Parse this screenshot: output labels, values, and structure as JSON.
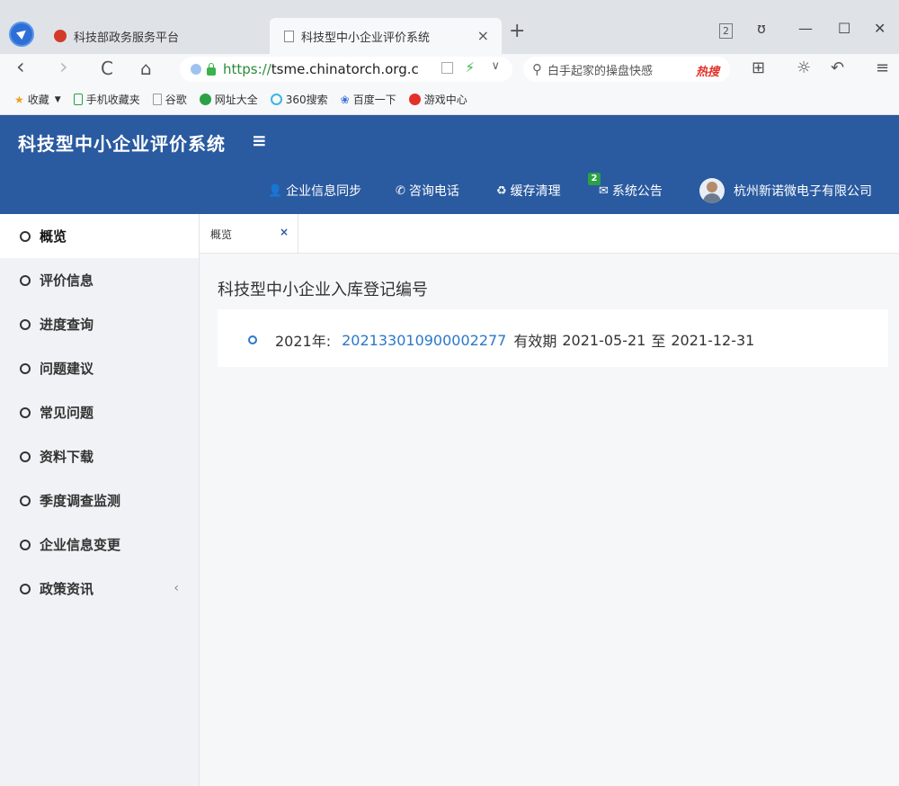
{
  "browser": {
    "tabs": [
      {
        "title": "科技部政务服务平台",
        "active": false
      },
      {
        "title": "科技型中小企业评价系统",
        "active": true
      }
    ],
    "new_tab": "+",
    "tab_count": "2",
    "window_controls": {
      "skin": "ʊ",
      "minimize": "—",
      "maximize": "☐",
      "close": "✕"
    },
    "nav": {
      "back": "‹",
      "forward": "›",
      "reload": "C",
      "home": "⌂"
    },
    "address": {
      "scheme": "https://",
      "host": "tsme.chinatorch.org.c"
    },
    "search": {
      "text": "白手起家的操盘快感",
      "hot_label": "热搜"
    },
    "bookmarks": [
      {
        "label": "收藏",
        "icon": "star-icon",
        "color": "#f0a020"
      },
      {
        "label": "手机收藏夹",
        "icon": "phone-icon",
        "color": "#2aa146"
      },
      {
        "label": "谷歌",
        "icon": "page-icon",
        "color": "#999999"
      },
      {
        "label": "网址大全",
        "icon": "globe-icon",
        "color": "#2aa146"
      },
      {
        "label": "360搜索",
        "icon": "search360-icon",
        "color": "#3cb5e5"
      },
      {
        "label": "百度一下",
        "icon": "paw-icon",
        "color": "#3a6fd6"
      },
      {
        "label": "游戏中心",
        "icon": "game-icon",
        "color": "#e3312a"
      }
    ]
  },
  "app": {
    "title": "科技型中小企业评价系统",
    "menu_toggle": "≡",
    "nav": {
      "sync": "企业信息同步",
      "phone": "咨询电话",
      "cache": "缓存清理",
      "notice": "系统公告",
      "notice_badge": "2",
      "company": "杭州新诺微电子有限公司"
    },
    "brand_color": "#2a5aa0"
  },
  "sidebar": {
    "items": [
      {
        "label": "概览",
        "active": true
      },
      {
        "label": "评价信息"
      },
      {
        "label": "进度查询"
      },
      {
        "label": "问题建议"
      },
      {
        "label": "常见问题"
      },
      {
        "label": "资料下载"
      },
      {
        "label": "季度调查监测"
      },
      {
        "label": "企业信息变更"
      },
      {
        "label": "政策资讯",
        "caret": "‹"
      }
    ]
  },
  "content": {
    "tab_label": "概览",
    "tab_close": "×",
    "section_title": "科技型中小企业入库登记编号",
    "record": {
      "year_label": "2021年:",
      "reg_number": "202133010900002277",
      "validity_label": "有效期",
      "start": "2021-05-21",
      "to": "至",
      "end": "2021-12-31"
    }
  }
}
